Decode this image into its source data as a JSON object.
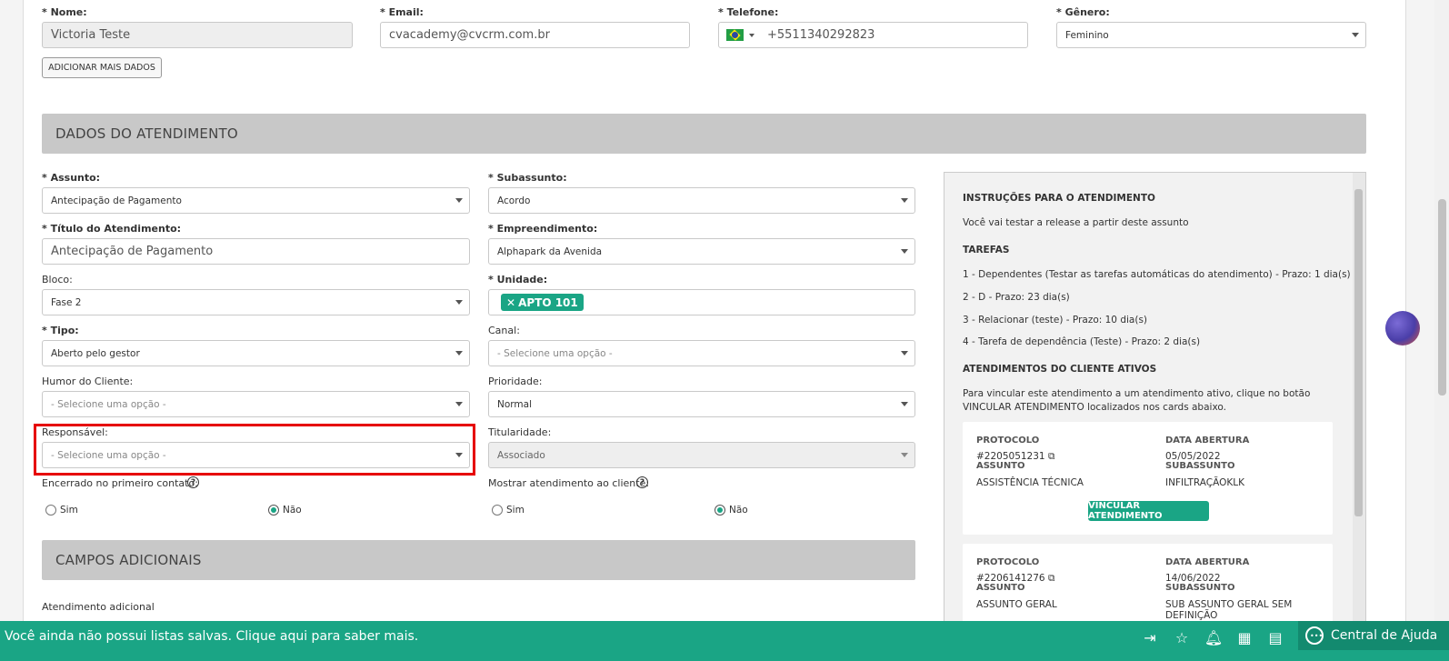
{
  "contact": {
    "nome_label": "* Nome:",
    "nome_value": "Victoria Teste",
    "email_label": "* Email:",
    "email_value": "cvacademy@cvcrm.com.br",
    "telefone_label": "* Telefone:",
    "telefone_value": "+5511340292823",
    "genero_label": "* Gênero:",
    "genero_value": "Feminino",
    "add_more_label": "ADICIONAR MAIS DADOS"
  },
  "section_atendimento": "DADOS DO ATENDIMENTO",
  "section_campos": "CAMPOS ADICIONAIS",
  "form": {
    "assunto_label": "* Assunto:",
    "assunto_value": "Antecipação de Pagamento",
    "subassunto_label": "* Subassunto:",
    "subassunto_value": "Acordo",
    "titulo_label": "* Título do Atendimento:",
    "titulo_value": "Antecipação de Pagamento",
    "empreendimento_label": "* Empreendimento:",
    "empreendimento_value": "Alphapark da Avenida",
    "bloco_label": "Bloco:",
    "bloco_value": "Fase 2",
    "unidade_label": "* Unidade:",
    "unidade_tag": "APTO 101",
    "tipo_label": "* Tipo:",
    "tipo_value": "Aberto pelo gestor",
    "canal_label": "Canal:",
    "canal_value": "- Selecione uma opção -",
    "humor_label": "Humor do Cliente:",
    "humor_value": "- Selecione uma opção -",
    "prioridade_label": "Prioridade:",
    "prioridade_value": "Normal",
    "responsavel_label": "Responsável:",
    "responsavel_value": "- Selecione uma opção -",
    "titularidade_label": "Titularidade:",
    "titularidade_value": "Associado",
    "encerrado_label": "Encerrado no primeiro contato:",
    "mostrar_label": "Mostrar atendimento ao cliente:",
    "sim": "Sim",
    "nao": "Não",
    "adicional_label": "Atendimento adicional"
  },
  "panel": {
    "instr_title": "INSTRUÇÕES PARA O ATENDIMENTO",
    "instr_text": "Você vai testar a release a partir deste assunto",
    "tarefas_title": "TAREFAS",
    "tarefas": [
      "1 - Dependentes (Testar as tarefas automáticas do atendimento) - Prazo: 1 dia(s)",
      "2 - D - Prazo: 23 dia(s)",
      "3 - Relacionar (teste) - Prazo: 10 dia(s)",
      "4 - Tarefa de dependência (Teste) - Prazo: 2 dia(s)"
    ],
    "ativos_title": "ATENDIMENTOS DO CLIENTE ATIVOS",
    "ativos_text_1": "Para vincular este atendimento a um atendimento ativo, clique no botão",
    "ativos_text_2": "VINCULAR ATENDIMENTO localizados nos cards abaixo.",
    "protocolo_h": "PROTOCOLO",
    "data_h": "DATA ABERTURA",
    "assunto_h": "ASSUNTO",
    "subassunto_h": "SUBASSUNTO",
    "cards": [
      {
        "protocolo": "#2205051231",
        "data": "05/05/2022",
        "assunto": "ASSISTÊNCIA TÉCNICA",
        "subassunto": "INFILTRAÇÃOKLK"
      },
      {
        "protocolo": "#2206141276",
        "data": "14/06/2022",
        "assunto": "ASSUNTO GERAL",
        "subassunto": "SUB ASSUNTO GERAL SEM DEFINIÇÃO"
      }
    ],
    "vincular_label": "VINCULAR ATENDIMENTO"
  },
  "bottombar": {
    "message": "Você ainda não possui listas salvas. Clique aqui para saber mais.",
    "help_label": "Central de Ajuda"
  },
  "colors": {
    "accent": "#1aa585",
    "highlight": "#e60000",
    "section_bg": "#c8c8c8"
  }
}
